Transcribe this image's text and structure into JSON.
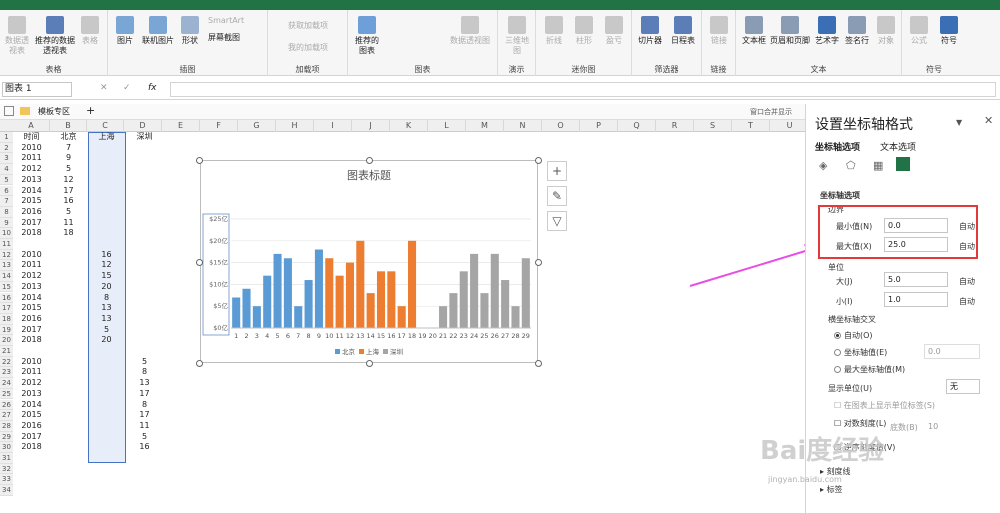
{
  "ribbon": {
    "groups": [
      {
        "label": "表格",
        "buttons": [
          "数据透视表",
          "推荐的数据透视表",
          "表格"
        ]
      },
      {
        "label": "插图",
        "buttons": [
          "图片",
          "联机图片",
          "形状",
          "SmartArt",
          "屏幕截图"
        ]
      },
      {
        "label": "加载项",
        "buttons": [
          "获取加载项",
          "我的加载项"
        ]
      },
      {
        "label": "图表",
        "buttons": [
          "推荐的图表",
          "数据透视图"
        ]
      },
      {
        "label": "演示",
        "buttons": [
          "三维地图"
        ]
      },
      {
        "label": "迷你图",
        "buttons": [
          "折线",
          "柱形",
          "盈亏"
        ]
      },
      {
        "label": "筛选器",
        "buttons": [
          "切片器",
          "日程表"
        ]
      },
      {
        "label": "链接",
        "buttons": [
          "链接"
        ]
      },
      {
        "label": "文本",
        "buttons": [
          "文本框",
          "页眉和页脚",
          "艺术字",
          "签名行",
          "对象"
        ]
      },
      {
        "label": "符号",
        "buttons": [
          "公式",
          "符号"
        ]
      }
    ]
  },
  "formula_bar": {
    "name_box": "图表 1",
    "fx": "fx"
  },
  "sheet_tabs": {
    "template": "模板专区",
    "plus": "+",
    "right": "窗口合并显示"
  },
  "columns": [
    "A",
    "B",
    "C",
    "D",
    "E",
    "F",
    "G",
    "H",
    "I",
    "J",
    "K",
    "L",
    "M",
    "N",
    "O",
    "P",
    "Q",
    "R",
    "S",
    "T",
    "U"
  ],
  "headers": {
    "a": "时间",
    "b": "北京",
    "c": "上海",
    "d": "深圳"
  },
  "rows_b": [
    [
      "2010",
      "7"
    ],
    [
      "2011",
      "9"
    ],
    [
      "2012",
      "5"
    ],
    [
      "2013",
      "12"
    ],
    [
      "2014",
      "17"
    ],
    [
      "2015",
      "16"
    ],
    [
      "2016",
      "5"
    ],
    [
      "2017",
      "11"
    ],
    [
      "2018",
      "18"
    ]
  ],
  "rows_c": [
    [
      "2010",
      "16"
    ],
    [
      "2011",
      "12"
    ],
    [
      "2012",
      "15"
    ],
    [
      "2013",
      "20"
    ],
    [
      "2014",
      "8"
    ],
    [
      "2015",
      "13"
    ],
    [
      "2016",
      "13"
    ],
    [
      "2017",
      "5"
    ],
    [
      "2018",
      "20"
    ]
  ],
  "rows_d": [
    [
      "2010",
      "5"
    ],
    [
      "2011",
      "8"
    ],
    [
      "2012",
      "13"
    ],
    [
      "2013",
      "17"
    ],
    [
      "2014",
      "8"
    ],
    [
      "2015",
      "17"
    ],
    [
      "2016",
      "11"
    ],
    [
      "2017",
      "5"
    ],
    [
      "2018",
      "16"
    ]
  ],
  "row_numbers": [
    "1",
    "2",
    "3",
    "4",
    "5",
    "6",
    "7",
    "8",
    "9",
    "10",
    "11",
    "12",
    "13",
    "14",
    "15",
    "16",
    "17",
    "18",
    "19",
    "20",
    "21",
    "22",
    "23",
    "24",
    "25",
    "26",
    "27",
    "28",
    "29",
    "30",
    "31",
    "32",
    "33",
    "34"
  ],
  "chart_data": {
    "type": "bar",
    "title": "图表标题",
    "categories": [
      "1",
      "2",
      "3",
      "4",
      "5",
      "6",
      "7",
      "8",
      "9",
      "10",
      "11",
      "12",
      "13",
      "14",
      "15",
      "16",
      "17",
      "18",
      "19",
      "20",
      "21",
      "22",
      "23",
      "24",
      "25",
      "26",
      "27",
      "28",
      "29"
    ],
    "series": [
      {
        "name": "北京",
        "color": "#5b9bd5",
        "values": [
          7,
          9,
          5,
          12,
          17,
          16,
          5,
          11,
          18,
          null,
          null,
          null,
          null,
          null,
          null,
          null,
          null,
          null,
          null,
          null,
          null,
          null,
          null,
          null,
          null,
          null,
          null,
          null,
          null
        ]
      },
      {
        "name": "上海",
        "color": "#ed7d31",
        "values": [
          null,
          null,
          null,
          null,
          null,
          null,
          null,
          null,
          null,
          16,
          12,
          15,
          20,
          8,
          13,
          13,
          5,
          20,
          null,
          null,
          null,
          null,
          null,
          null,
          null,
          null,
          null,
          null,
          null
        ]
      },
      {
        "name": "深圳",
        "color": "#a5a5a5",
        "values": [
          null,
          null,
          null,
          null,
          null,
          null,
          null,
          null,
          null,
          null,
          null,
          null,
          null,
          null,
          null,
          null,
          null,
          null,
          null,
          null,
          5,
          8,
          13,
          17,
          8,
          17,
          11,
          5,
          16
        ]
      }
    ],
    "ylim": [
      0,
      25
    ],
    "yticks": [
      "$0亿",
      "$5亿",
      "$10亿",
      "$15亿",
      "$20亿",
      "$25亿"
    ]
  },
  "pane": {
    "title": "设置坐标轴格式",
    "tab_axis": "坐标轴选项",
    "tab_text": "文本选项",
    "section": "坐标轴选项",
    "bounds": "边界",
    "min_label": "最小值(N)",
    "min_value": "0.0",
    "max_label": "最大值(X)",
    "max_value": "25.0",
    "units": "单位",
    "major_label": "大(J)",
    "major_value": "5.0",
    "minor_label": "小(I)",
    "minor_value": "1.0",
    "auto": "自动",
    "cross": "横坐标轴交叉",
    "cross_auto": "自动(O)",
    "cross_value_label": "坐标轴值(E)",
    "cross_value": "0.0",
    "cross_max": "最大坐标轴值(M)",
    "display_units": "显示单位(U)",
    "display_units_value": "无",
    "show_label": "在图表上显示单位标签(S)",
    "log": "对数刻度(L)",
    "log_base": "底数(B)",
    "log_base_value": "10",
    "reverse": "逆序刻度值(V)",
    "ticks": "刻度线",
    "labels": "标签"
  },
  "watermark": "Bai度经验",
  "watermark_url": "jingyan.baidu.com"
}
